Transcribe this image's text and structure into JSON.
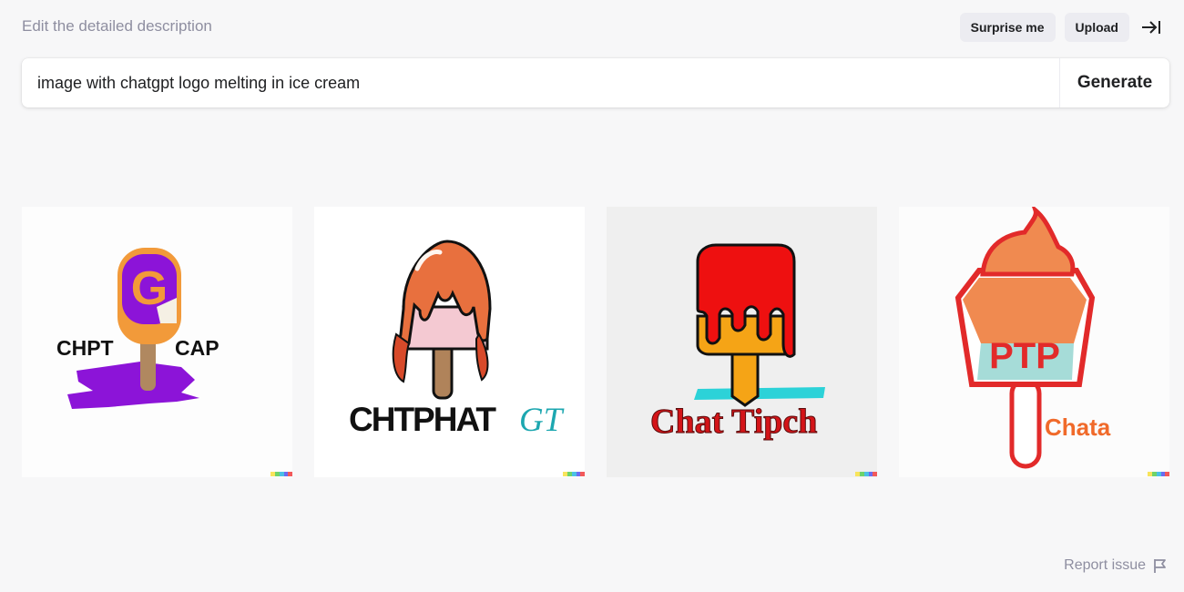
{
  "header": {
    "label": "Edit the detailed description",
    "surprise_label": "Surprise me",
    "upload_label": "Upload",
    "collapse_icon": "arrow-to-right-icon"
  },
  "prompt": {
    "value": "image with chatgpt logo melting in ice cream",
    "generate_label": "Generate"
  },
  "gallery": {
    "images": [
      {
        "texts": [
          "CHPT",
          "CAP"
        ],
        "colors": {
          "main": "#8c14d8",
          "rim": "#f29a3a",
          "stick": "#b08860"
        }
      },
      {
        "texts": [
          "CHTPHAT",
          "GT"
        ],
        "colors": {
          "main": "#e8703e",
          "drip": "#d84a2a",
          "base": "#f4c9d2"
        }
      },
      {
        "texts": [
          "Chat Tipch"
        ],
        "colors": {
          "main": "#ee1010",
          "base": "#f5a416",
          "swoosh": "#2cd2d8"
        }
      },
      {
        "texts": [
          "PTP",
          "Chata"
        ],
        "colors": {
          "main": "#e22a2a",
          "cream": "#f08a50",
          "tint": "#a6dcd8"
        }
      }
    ],
    "watermark_colors": [
      "#f8e45c",
      "#6fd36a",
      "#4bc0e6",
      "#6b6cf1",
      "#f2595a"
    ]
  },
  "footer": {
    "report_label": "Report issue",
    "report_icon": "flag-icon"
  }
}
